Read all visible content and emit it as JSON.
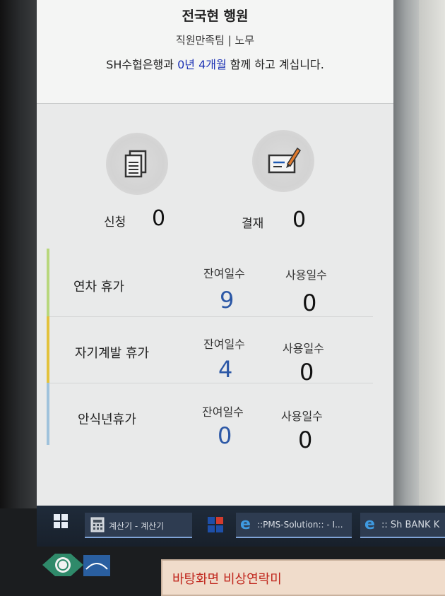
{
  "profile": {
    "name": "전국현 행원",
    "department": "직원만족팀 | 노무",
    "tenure_prefix": "SH수협은행과 ",
    "tenure_highlight": "0년 4개월",
    "tenure_suffix": " 함께 하고 계십니다."
  },
  "stats": {
    "apply_label": "신청",
    "apply_value": "0",
    "approve_label": "결재",
    "approve_value": "0"
  },
  "leaves": [
    {
      "name": "연차 휴가",
      "remain_label": "잔여일수",
      "remain": "9",
      "used_label": "사용일수",
      "used": "0",
      "accent": "#b8d77c"
    },
    {
      "name": "자기계발 휴가",
      "remain_label": "잔여일수",
      "remain": "4",
      "used_label": "사용일수",
      "used": "0",
      "accent": "#e3c23c"
    },
    {
      "name": "안식년휴가",
      "remain_label": "잔여일수",
      "remain": "0",
      "used_label": "사용일수",
      "used": "0",
      "accent": "#9fc2dc"
    }
  ],
  "taskbar": {
    "calc": "계산기 - 계산기",
    "pms": "::PMS-Solution:: - I...",
    "sh": ":: Sh BANK K"
  },
  "sticky_note": "바탕화면 비상연락미",
  "colors": {
    "accent_blue": "#2c58a6",
    "tenure_blue": "#1c32b4"
  }
}
